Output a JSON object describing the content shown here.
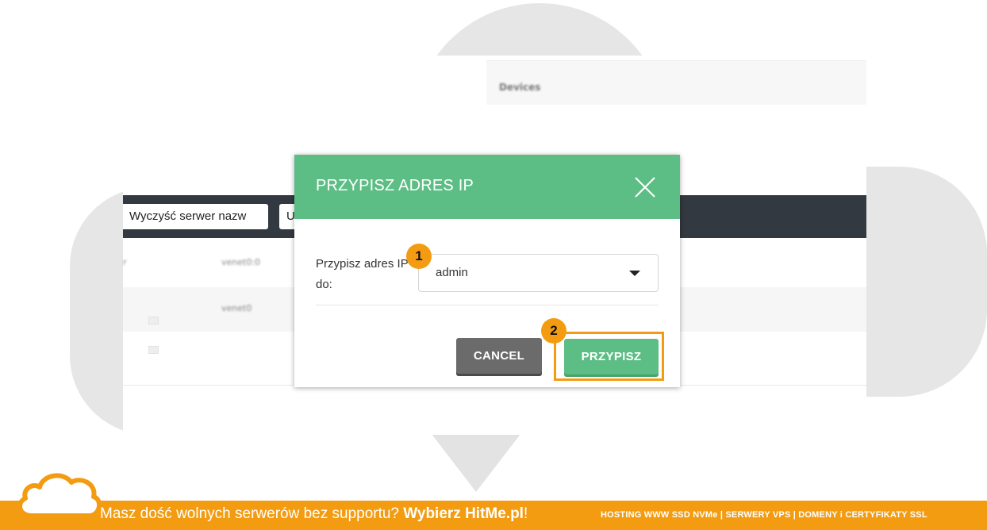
{
  "background": {
    "devices_label": "Devices",
    "toolbar_button_1": "Wyczyść serwer nazw",
    "toolbar_button_2": "U",
    "rows": [
      {
        "col_left": "r",
        "col_iface": "venet0:0"
      },
      {
        "col_left": "",
        "col_iface": "venet0"
      },
      {
        "col_left": "",
        "col_iface": ""
      }
    ]
  },
  "modal": {
    "title": "PRZYPISZ ADRES IP",
    "field_label": "Przypisz adres IP do:",
    "selected_value": "admin",
    "cancel_label": "CANCEL",
    "assign_label": "PRZYPISZ",
    "colors": {
      "header": "#5dbe85",
      "cancel": "#6b6b6b",
      "highlight": "#f39c12"
    }
  },
  "annotations": {
    "step_1": "1",
    "step_2": "2"
  },
  "footer": {
    "promo_text": "Masz dość wolnych serwerów bez supportu? ",
    "promo_brand": "Wybierz HitMe.pl",
    "promo_end": "!",
    "services": "HOSTING WWW SSD NVMe | SERWERY VPS | DOMENY i CERTYFIKATY SSL"
  },
  "icons": {
    "close": "close-icon",
    "dropdown": "chevron-down-icon",
    "logo": "cloud-logo-icon"
  }
}
